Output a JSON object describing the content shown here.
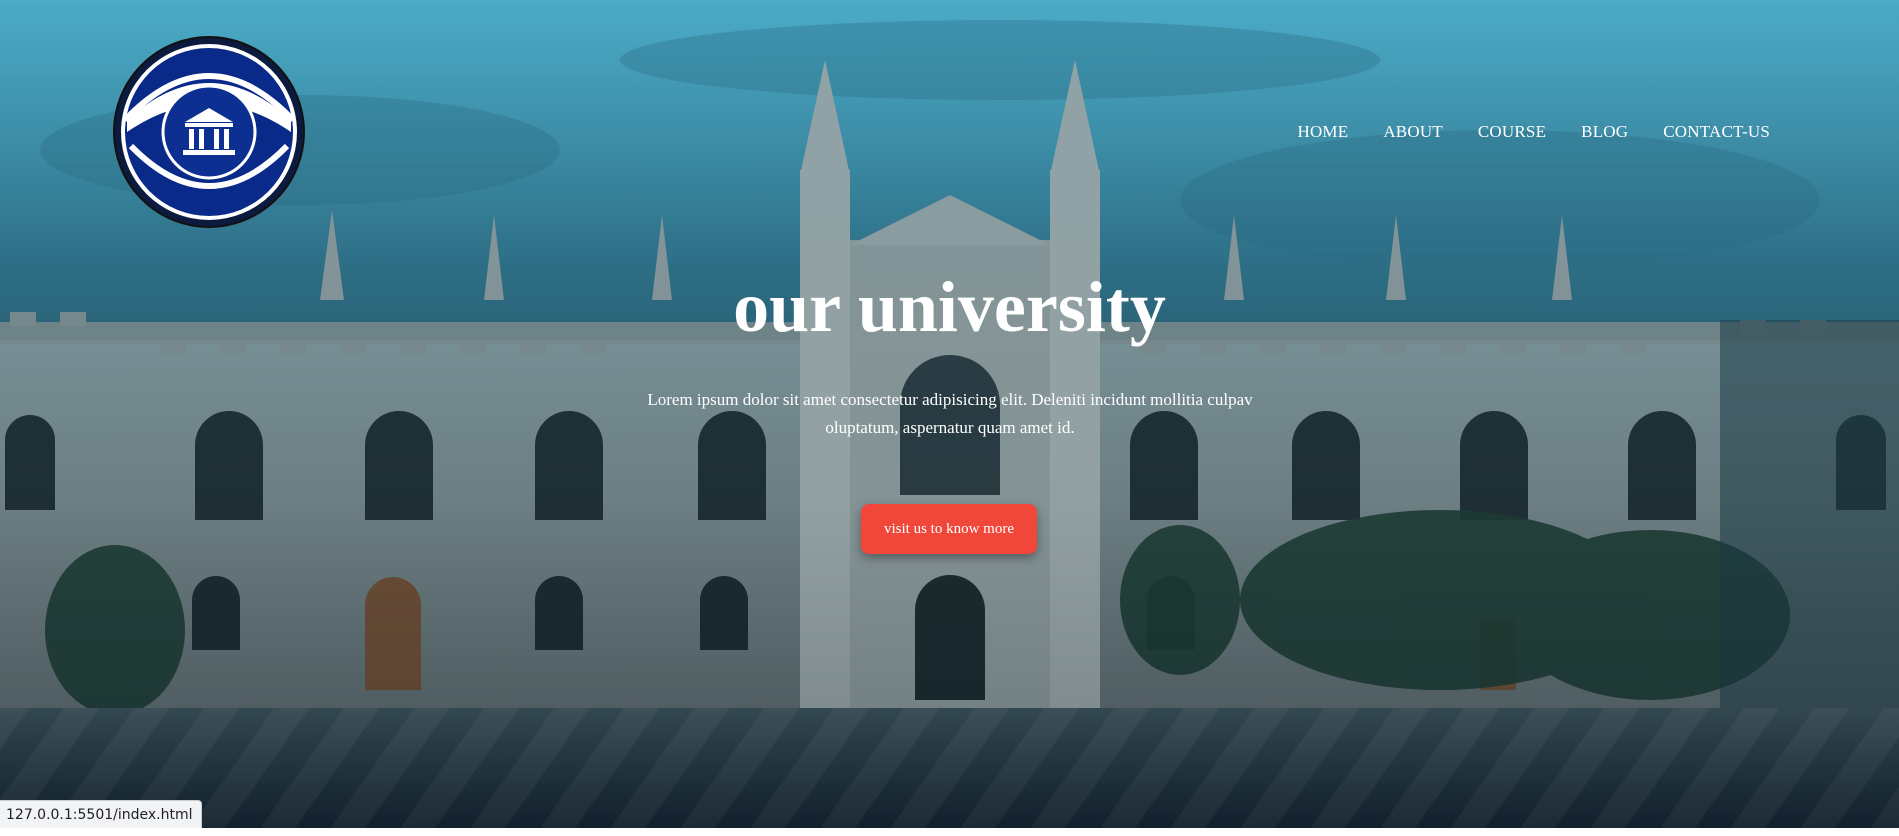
{
  "logo": {
    "icon": "university-building-icon"
  },
  "nav": {
    "items": [
      "HOME",
      "ABOUT",
      "COURSE",
      "BLOG",
      "CONTACT-US"
    ]
  },
  "hero": {
    "title": "our university",
    "description": "Lorem ipsum dolor sit amet consectetur adipisicing elit. Deleniti incidunt mollitia culpav oluptatum, aspernatur quam amet id.",
    "cta_label": "visit us to know more"
  },
  "status": {
    "url": "127.0.0.1:5501/index.html"
  },
  "colors": {
    "cta": "#f0473a",
    "logo_navy": "#0a2a8a",
    "sky": "#4fb0cc"
  }
}
